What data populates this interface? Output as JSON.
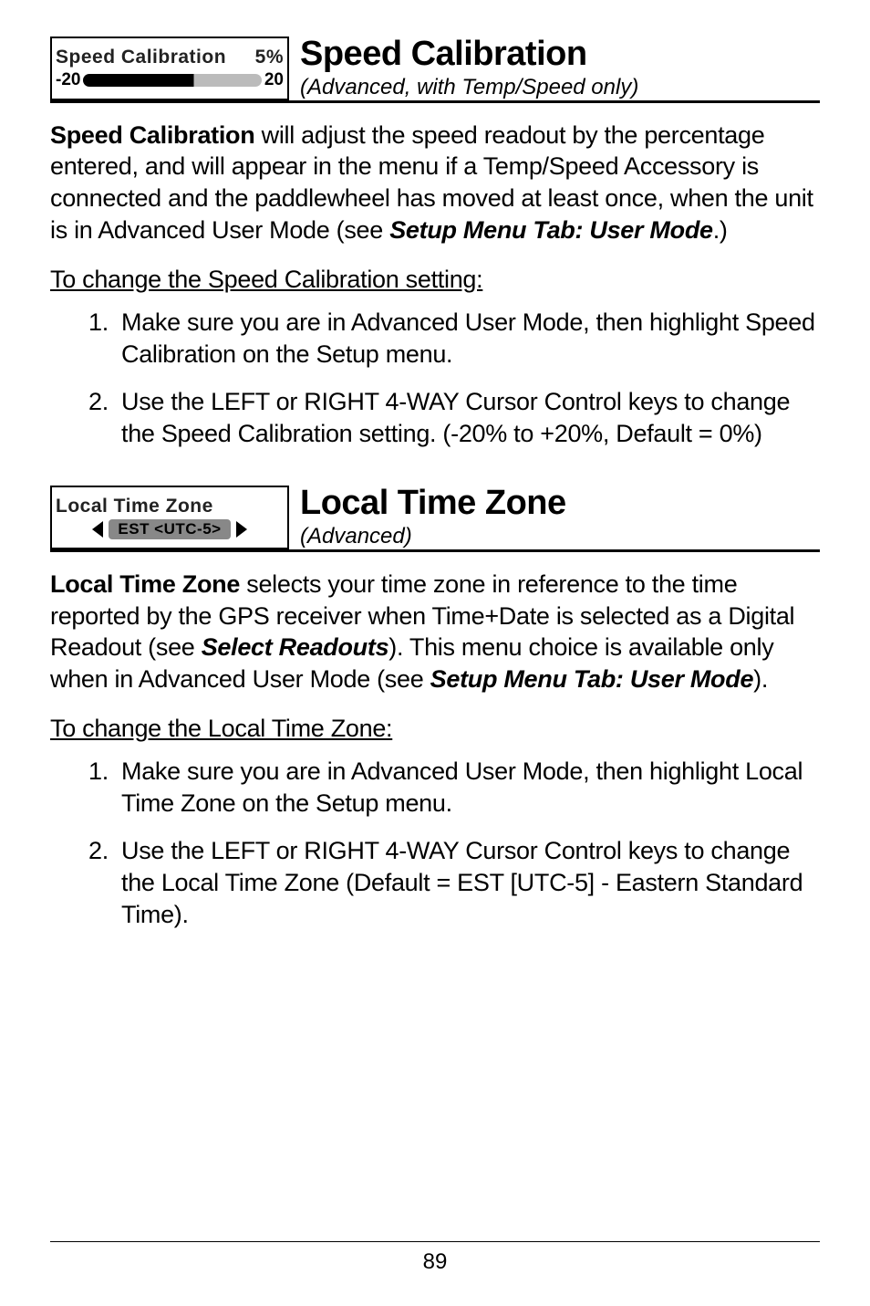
{
  "sections": [
    {
      "inset": {
        "type": "slider",
        "label": "Speed Calibration",
        "value": "5%",
        "min": "-20",
        "max": "20"
      },
      "title": "Speed Calibration",
      "subtitle": "(Advanced, with Temp/Speed only)",
      "body_lead": "Speed Calibration",
      "body_rest": " will adjust the speed readout by the percentage entered, and will appear in the menu if a Temp/Speed Accessory is connected and the paddlewheel has moved at least once, when the unit is in Advanced User Mode (see ",
      "body_ital": "Setup Menu Tab: User Mode",
      "body_tail": ".)",
      "procedure_title": "To change the Speed Calibration setting:",
      "steps": [
        "Make sure you are in Advanced User Mode, then highlight Speed Calibration on the Setup menu.",
        "Use the LEFT or RIGHT 4-WAY Cursor Control keys to change the Speed Calibration setting. (-20% to +20%, Default = 0%)"
      ]
    },
    {
      "inset": {
        "type": "select",
        "label": "Local Time Zone",
        "value": "EST <UTC-5>"
      },
      "title": "Local Time Zone",
      "subtitle": "(Advanced)",
      "body_lead": "Local Time Zone",
      "body_rest": " selects your time zone in reference to the time reported by the GPS receiver when Time+Date is selected as a Digital Readout (see ",
      "body_ital": "Select Readouts",
      "body_tail2": "). This menu choice is available only when in Advanced User Mode (see ",
      "body_ital2": "Setup Menu Tab: User Mode",
      "body_tail3": ").",
      "procedure_title": "To change the Local Time Zone:",
      "steps": [
        "Make sure you are in Advanced User Mode, then highlight Local Time Zone on the Setup menu.",
        "Use the LEFT or RIGHT 4-WAY Cursor Control keys to change the Local Time Zone (Default = EST [UTC-5] - Eastern Standard Time)."
      ]
    }
  ],
  "page_number": "89"
}
